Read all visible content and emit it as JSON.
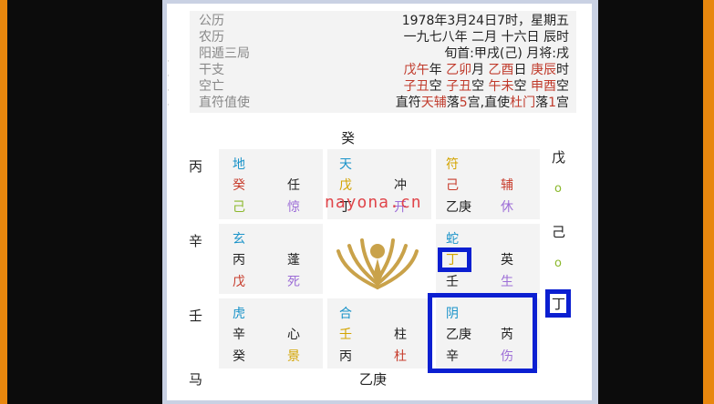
{
  "info": {
    "rows": [
      {
        "label": "公历",
        "value_parts": [
          "1978年3月24日7时，星期五"
        ]
      },
      {
        "label": "农历",
        "value_parts": [
          "一九七八年 二月 十六日 辰时"
        ]
      },
      {
        "label": "阳遁三局",
        "value_parts": [
          "旬首:甲戌(己) 月将:戌"
        ]
      },
      {
        "label": "干支",
        "value_parts": [
          "戊午",
          "年 ",
          "乙卯",
          "月 ",
          "乙酉",
          "日 ",
          "庚辰",
          "时"
        ]
      },
      {
        "label": "空亡",
        "value_parts": [
          "子丑",
          "空 ",
          "子丑",
          "空 ",
          "午未",
          "空 ",
          "申酉",
          "空"
        ]
      },
      {
        "label": "直符值使",
        "value_parts": [
          "直符",
          "天辅",
          "落",
          "5",
          "宫,直使",
          "杜门",
          "落",
          "1",
          "宫"
        ]
      }
    ]
  },
  "top_char": "癸",
  "bottom_char": "乙庚",
  "left_chars": [
    "丙",
    "辛",
    "壬",
    "马"
  ],
  "right_chars": [
    "戊",
    "o",
    "己",
    "o",
    "丁"
  ],
  "cells": {
    "c00": {
      "tl": "地",
      "ml": "癸",
      "mr": "任",
      "bl": "己",
      "br": "惊"
    },
    "c01": {
      "tl": "天",
      "ml": "戊",
      "mr": "冲",
      "bl": "丁",
      "br": "开"
    },
    "c02": {
      "tl": "符",
      "ml": "己",
      "mr": "辅",
      "bl": "乙庚",
      "br": "休"
    },
    "c10": {
      "tl": "玄",
      "ml": "丙",
      "mr": "蓬",
      "bl": "戊",
      "br": "死"
    },
    "c12": {
      "tl": "蛇",
      "ml": "丁",
      "mr": "英",
      "bl": "壬",
      "br": "生"
    },
    "c20": {
      "tl": "虎",
      "ml": "辛",
      "mr": "心",
      "bl": "癸",
      "br": "景"
    },
    "c21": {
      "tl": "合",
      "ml": "壬",
      "mr": "柱",
      "bl": "丙",
      "br": "杜"
    },
    "c22": {
      "tl": "阴",
      "ml": "乙庚",
      "mr": "芮",
      "bl": "辛",
      "br": "伤"
    }
  },
  "watermark": "nayona.cn",
  "colors": {
    "highlight": "#0b1fd1",
    "background": "#e8870e"
  }
}
